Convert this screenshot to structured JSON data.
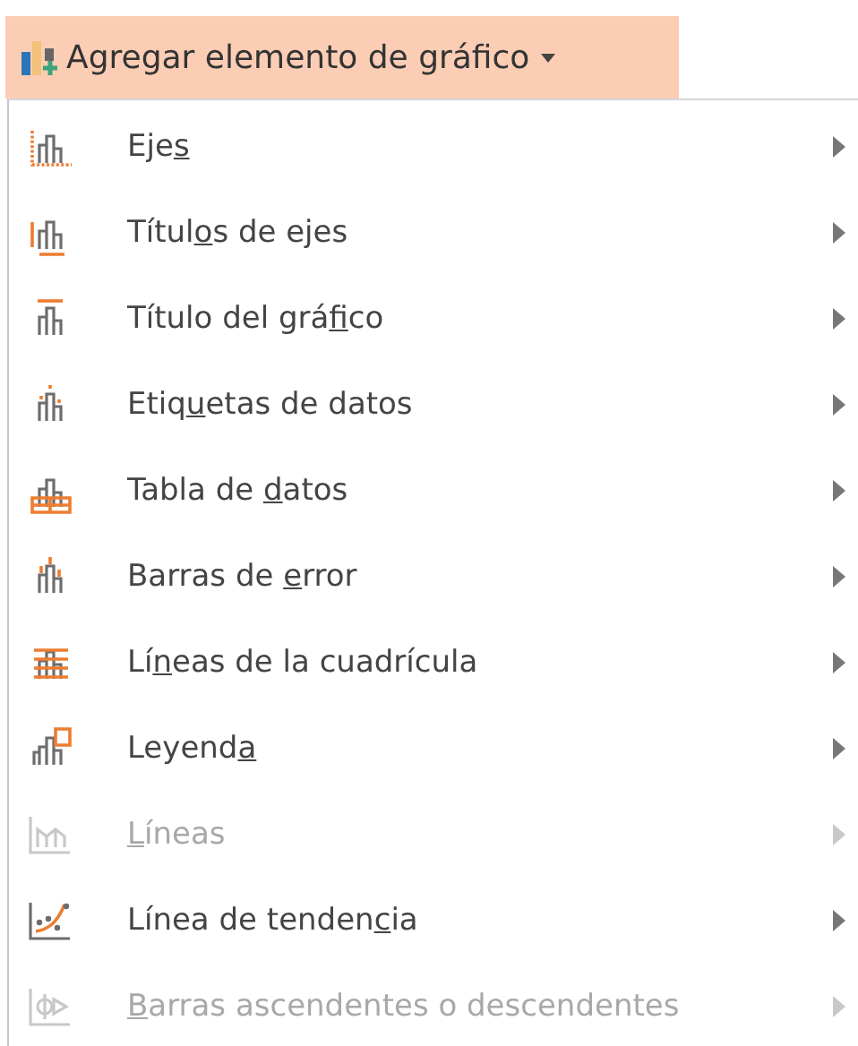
{
  "button": {
    "label": "Agregar elemento de gráfico"
  },
  "menu": {
    "items": [
      {
        "label": {
          "before": "Eje",
          "key": "s"
        },
        "disabled": false
      },
      {
        "label": {
          "before": "Títul",
          "key": "o",
          "after": "s de ejes"
        },
        "disabled": false
      },
      {
        "label": {
          "before": "Título del grá",
          "key": "f",
          "after": "ico"
        },
        "disabled": false
      },
      {
        "label": {
          "before": "Etiq",
          "key": "u",
          "after": "etas de datos"
        },
        "disabled": false
      },
      {
        "label": {
          "before": "Tabla de ",
          "key": "d",
          "after": "atos"
        },
        "disabled": false
      },
      {
        "label": {
          "before": "Barras de ",
          "key": "e",
          "after": "rror"
        },
        "disabled": false
      },
      {
        "label": {
          "before": "Lí",
          "key": "n",
          "after": "eas de la cuadrícula"
        },
        "disabled": false
      },
      {
        "label": {
          "before": "Leyend",
          "key": "a"
        },
        "disabled": false
      },
      {
        "label": {
          "key": "L",
          "after": "íneas"
        },
        "disabled": true
      },
      {
        "label": {
          "before": "Línea de tenden",
          "key": "c",
          "after": "ia"
        },
        "disabled": false
      },
      {
        "label": {
          "key": "B",
          "after": "arras ascendentes o descendentes"
        },
        "disabled": true
      }
    ]
  }
}
